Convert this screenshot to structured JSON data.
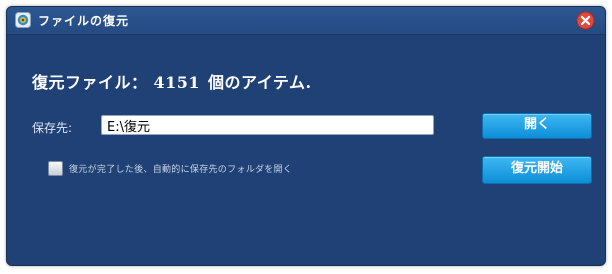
{
  "window": {
    "title": "ファイルの復元"
  },
  "summary": {
    "prefix": "復元ファイル：",
    "count": "4151",
    "suffix": "個のアイテム."
  },
  "save": {
    "label": "保存先:",
    "path": "E:\\復元"
  },
  "buttons": {
    "open": "開く",
    "start": "復元開始"
  },
  "option": {
    "label": "復元が完了した後、自動的に保存先のフォルダを開く",
    "checked": false
  },
  "colors": {
    "window_bg": "#1f4176",
    "button": "#1aa0e6",
    "close": "#e04a3e"
  },
  "icons": {
    "app": "app-icon",
    "close": "close-icon"
  }
}
